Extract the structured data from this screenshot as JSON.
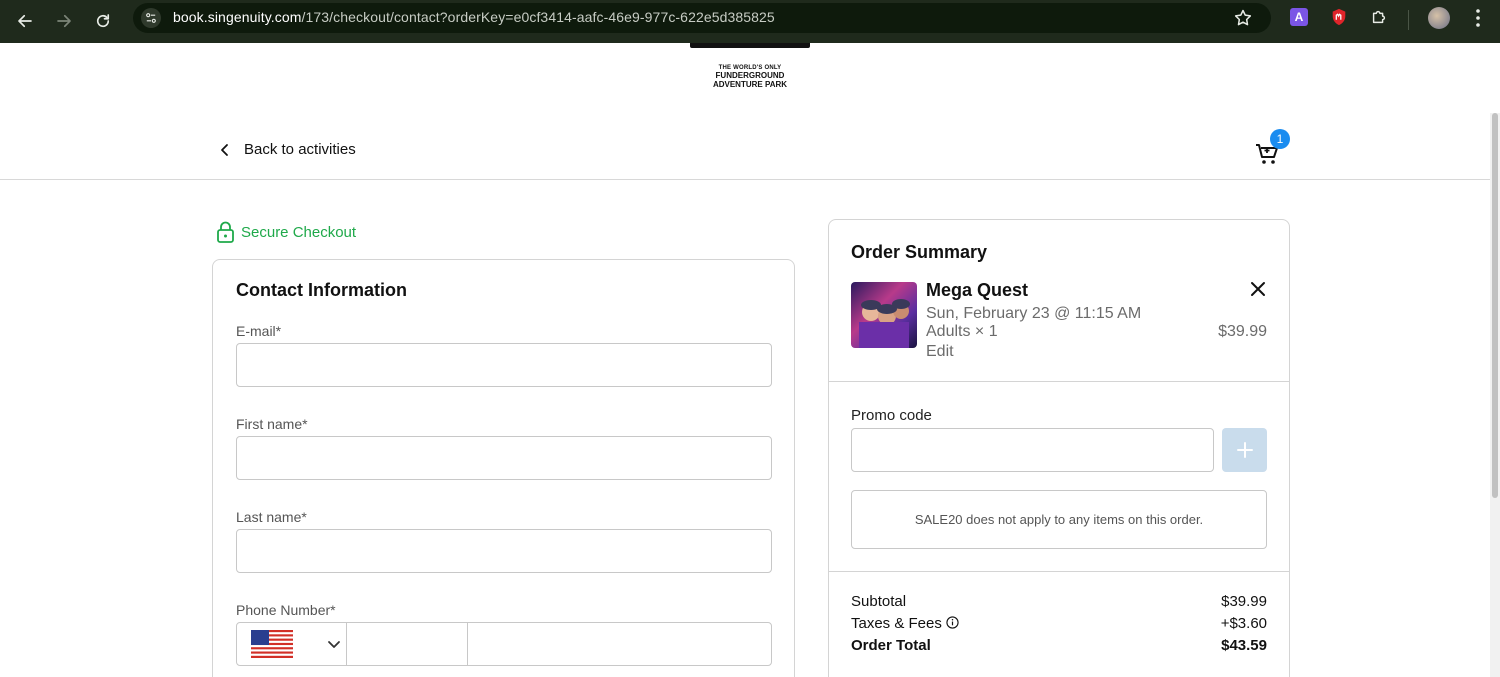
{
  "browser": {
    "url_host": "book.singenuity.com",
    "url_path": "/173/checkout/contact?orderKey=e0cf3414-aafc-46e9-977c-622e5d385825",
    "extension_a_label": "A"
  },
  "logo": {
    "line1": "THE WORLD'S ONLY",
    "line2": "FUNDERGROUND",
    "line3": "ADVENTURE PARK"
  },
  "header": {
    "back_label": "Back to activities",
    "cart_count": "1"
  },
  "checkout": {
    "secure_label": "Secure Checkout",
    "contact_title": "Contact Information",
    "email_label": "E-mail*",
    "first_name_label": "First name*",
    "last_name_label": "Last name*",
    "phone_label": "Phone Number*",
    "email_value": "",
    "first_name_value": "",
    "last_name_value": "",
    "phone_value": ""
  },
  "summary": {
    "title": "Order Summary",
    "item": {
      "name": "Mega Quest",
      "date": "Sun, February 23 @ 11:15 AM",
      "qty": "Adults × 1",
      "price": "$39.99",
      "edit_label": "Edit"
    },
    "promo_label": "Promo code",
    "promo_value": "",
    "promo_message": "SALE20 does not apply to any items on this order.",
    "subtotal_label": "Subtotal",
    "subtotal_value": "$39.99",
    "taxes_label": "Taxes & Fees",
    "taxes_value": "+$3.60",
    "total_label": "Order Total",
    "total_value": "$43.59"
  },
  "colors": {
    "secure_green": "#1fa94a",
    "badge_blue": "#1a8cf0",
    "promo_button_disabled": "#c9dcec",
    "chrome_bg": "#1f2a1c"
  }
}
